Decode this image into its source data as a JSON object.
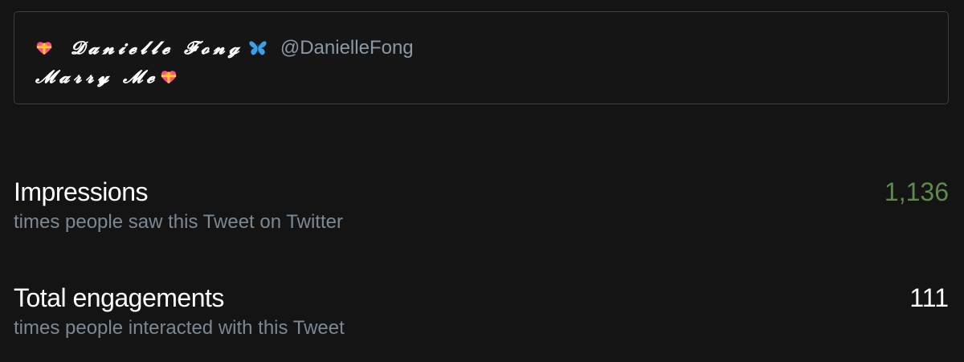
{
  "quoted_tweet": {
    "display_name": "𝓓𝓪𝓷𝓲𝓮𝓵𝓵𝓮 𝓕𝓸𝓷𝓰",
    "handle": "@DanielleFong",
    "text": "𝓜𝓪𝓻𝓻𝔂 𝓜𝓮",
    "name_prefix_icon": "heart-with-ribbon-icon",
    "name_suffix_icon": "butterfly-icon",
    "text_suffix_icon": "heart-with-ribbon-icon"
  },
  "metrics": [
    {
      "label": "Impressions",
      "description": "times people saw this Tweet on Twitter",
      "value": "1,136",
      "value_color": "#5f8a4b"
    },
    {
      "label": "Total engagements",
      "description": "times people interacted with this Tweet",
      "value": "111",
      "value_color": "#ffffff"
    }
  ],
  "colors": {
    "background": "#141414",
    "card_border": "#3a3f45",
    "muted_text": "#7c8893",
    "handle_text": "#8b98a5"
  }
}
